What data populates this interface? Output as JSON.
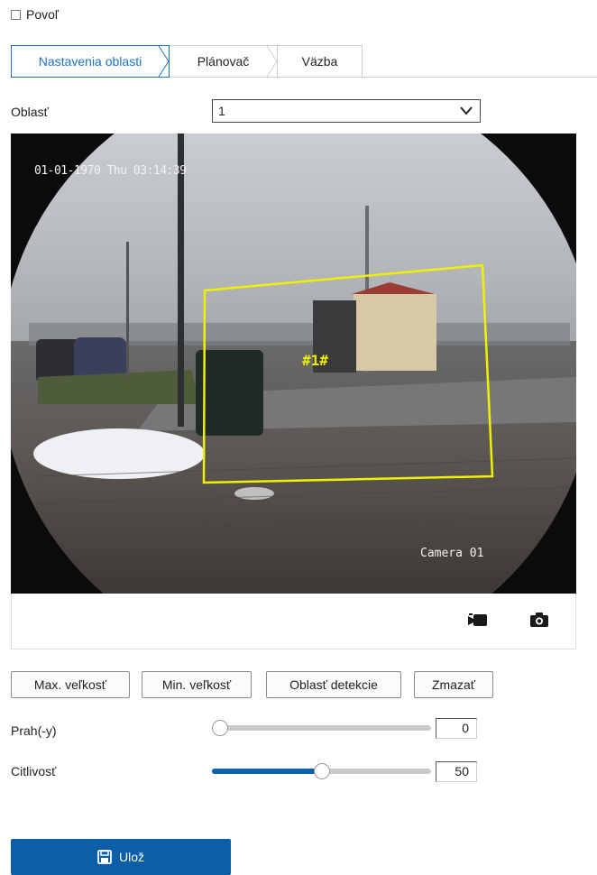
{
  "enable": {
    "label": "Povoľ",
    "checked": false
  },
  "tabs": [
    {
      "label": "Nastavenia oblasti",
      "active": true
    },
    {
      "label": "Plánovač",
      "active": false
    },
    {
      "label": "Väzba",
      "active": false
    }
  ],
  "area": {
    "label": "Oblasť",
    "selected": "1"
  },
  "video": {
    "osd_time": "01-01-1970 Thu 03:14:39",
    "camera_name": "Camera 01",
    "region_label": "#1#",
    "record_icon": "video-record-icon",
    "snapshot_icon": "camera-snapshot-icon"
  },
  "buttons": {
    "max_size": "Max. veľkosť",
    "min_size": "Min. veľkosť",
    "detection_area": "Oblasť detekcie",
    "clear": "Zmazať"
  },
  "threshold": {
    "label": "Prah(-y)",
    "value": "0",
    "fraction": 0.0
  },
  "sensitivity": {
    "label": "Citlivosť",
    "value": "50",
    "fraction": 0.5
  },
  "save": {
    "label": "Ulož",
    "icon": "save-icon"
  },
  "colors": {
    "accent": "#1f72c3",
    "primary_button": "#0d5ea8",
    "region": "#f0f000"
  }
}
